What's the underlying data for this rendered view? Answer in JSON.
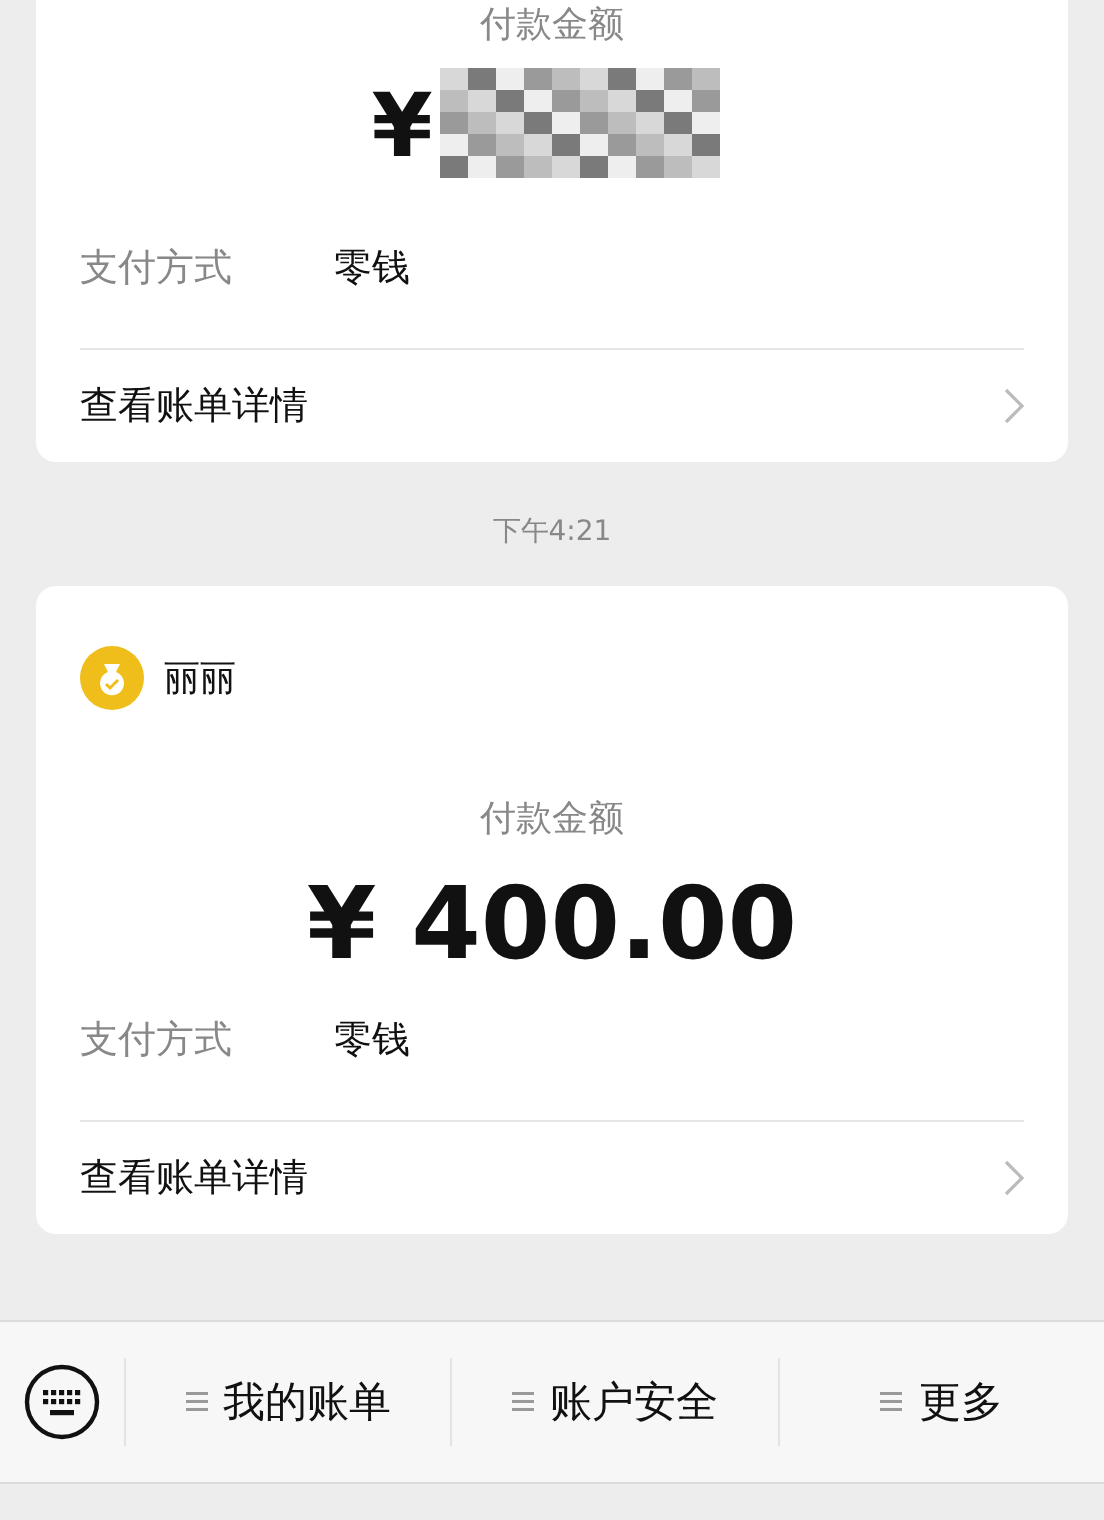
{
  "messages": [
    {
      "kind": "payment",
      "amount_label": "付款金额",
      "amount": "¥",
      "redacted": true,
      "method_label": "支付方式",
      "method": "零钱",
      "detail_link": "查看账单详情"
    },
    {
      "kind": "time",
      "time": "下午4:21"
    },
    {
      "kind": "payment",
      "merchant": "丽丽",
      "amount_label": "付款金额",
      "amount": "¥ 400.00",
      "redacted": false,
      "method_label": "支付方式",
      "method": "零钱",
      "detail_link": "查看账单详情"
    }
  ],
  "menu_bar": {
    "items": [
      {
        "label": "我的账单"
      },
      {
        "label": "账户安全"
      },
      {
        "label": "更多"
      }
    ]
  }
}
